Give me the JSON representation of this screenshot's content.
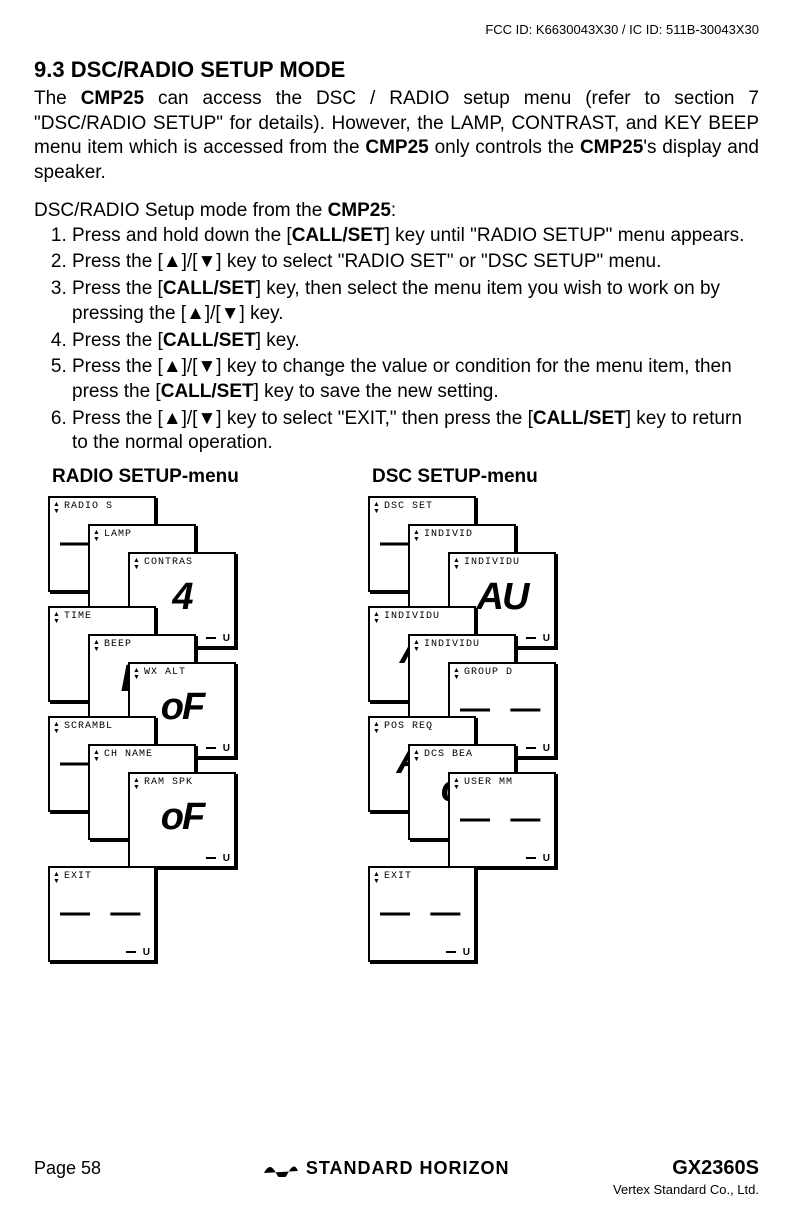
{
  "header": {
    "fcc": "FCC ID: K6630043X30 / IC ID: 511B-30043X30"
  },
  "section": {
    "number_title": "9.3  DSC/RADIO SETUP MODE",
    "p1_a": "The  ",
    "p1_cmptxt1": "CMP25",
    "p1_b": " can access the DSC / RADIO setup menu (refer to section 7 \"DSC/RADIO SETUP\" for details). However, the LAMP, CONTRAST, and KEY BEEP menu item which is accessed from the ",
    "p1_cmptxt2": "CMP25",
    "p1_c": " only controls the ",
    "p1_cmptxt3": "CMP25",
    "p1_d": "'s display and speaker.",
    "lead_a": "DSC/RADIO Setup mode from the ",
    "lead_b": "CMP25",
    "lead_c": ":",
    "steps": {
      "s1a": "Press and hold down the [",
      "s1b": "CALL/SET",
      "s1c": "] key until \"RADIO SETUP\" menu appears.",
      "s2": "Press the [▲]/[▼] key to select \"RADIO SET\" or \"DSC SETUP\" menu.",
      "s3a": "Press the [",
      "s3b": "CALL/SET",
      "s3c": "] key, then select the menu item you wish to work on by pressing the [▲]/[▼] key.",
      "s4a": "Press the [",
      "s4b": "CALL/SET",
      "s4c": "] key.",
      "s5a": "Press the [▲]/[▼] key to change the value or condition for the menu item, then press the [",
      "s5b": "CALL/SET",
      "s5c": "] key to save the new setting.",
      "s6a": "Press the [▲]/[▼] key to select \"EXIT,\" then press the [",
      "s6b": "CALL/SET",
      "s6c": "] key to return to the normal operation."
    }
  },
  "menus": {
    "radio": {
      "title": "RADIO SETUP-menu",
      "screens": [
        {
          "label": "RADIO S",
          "big": "",
          "dashes": "— —",
          "u": false
        },
        {
          "label": "LAMP",
          "big": "",
          "dashes": "",
          "u": false
        },
        {
          "label": "CONTRAS",
          "big": "4",
          "dashes": "",
          "u": true
        },
        {
          "label": "TIME",
          "big": "",
          "dashes": "",
          "u": false
        },
        {
          "label": "BEEP",
          "big": "Lo",
          "dashes": "",
          "u": false
        },
        {
          "label": "WX ALT",
          "big": "oF",
          "dashes": "",
          "u": true
        },
        {
          "label": "SCRAMBL",
          "big": "",
          "dashes": "— —",
          "u": false
        },
        {
          "label": "CH NAME",
          "big": "",
          "dashes": "",
          "u": false
        },
        {
          "label": "RAM SPK",
          "big": "oF",
          "dashes": "",
          "u": true
        },
        {
          "label": "EXIT",
          "big": "",
          "dashes": "— —",
          "u": true
        }
      ]
    },
    "dsc": {
      "title": "DSC SETUP-menu",
      "screens": [
        {
          "label": "DSC SET",
          "big": "",
          "dashes": "— —",
          "u": false
        },
        {
          "label": "INDIVID",
          "big": "",
          "dashes": "",
          "u": false
        },
        {
          "label": "INDIVIDU",
          "big": "AU",
          "dashes": "",
          "u": true
        },
        {
          "label": "INDIVIDU",
          "big": "Ac",
          "dashes": "",
          "u": false
        },
        {
          "label": "INDIVIDU",
          "big": "",
          "dashes": "",
          "u": false
        },
        {
          "label": "GROUP D",
          "big": "",
          "dashes": "— —",
          "u": true
        },
        {
          "label": "POS REQ",
          "big": "AU",
          "dashes": "",
          "u": false
        },
        {
          "label": "DCS BEA",
          "big": "on",
          "dashes": "",
          "u": false
        },
        {
          "label": "USER MM",
          "big": "",
          "dashes": "— —",
          "u": true
        },
        {
          "label": "EXIT",
          "big": "",
          "dashes": "— —",
          "u": true
        }
      ]
    }
  },
  "footer": {
    "page": "Page 58",
    "brand": "STANDARD HORIZON",
    "model": "GX2360S",
    "company": "Vertex Standard Co., Ltd."
  }
}
